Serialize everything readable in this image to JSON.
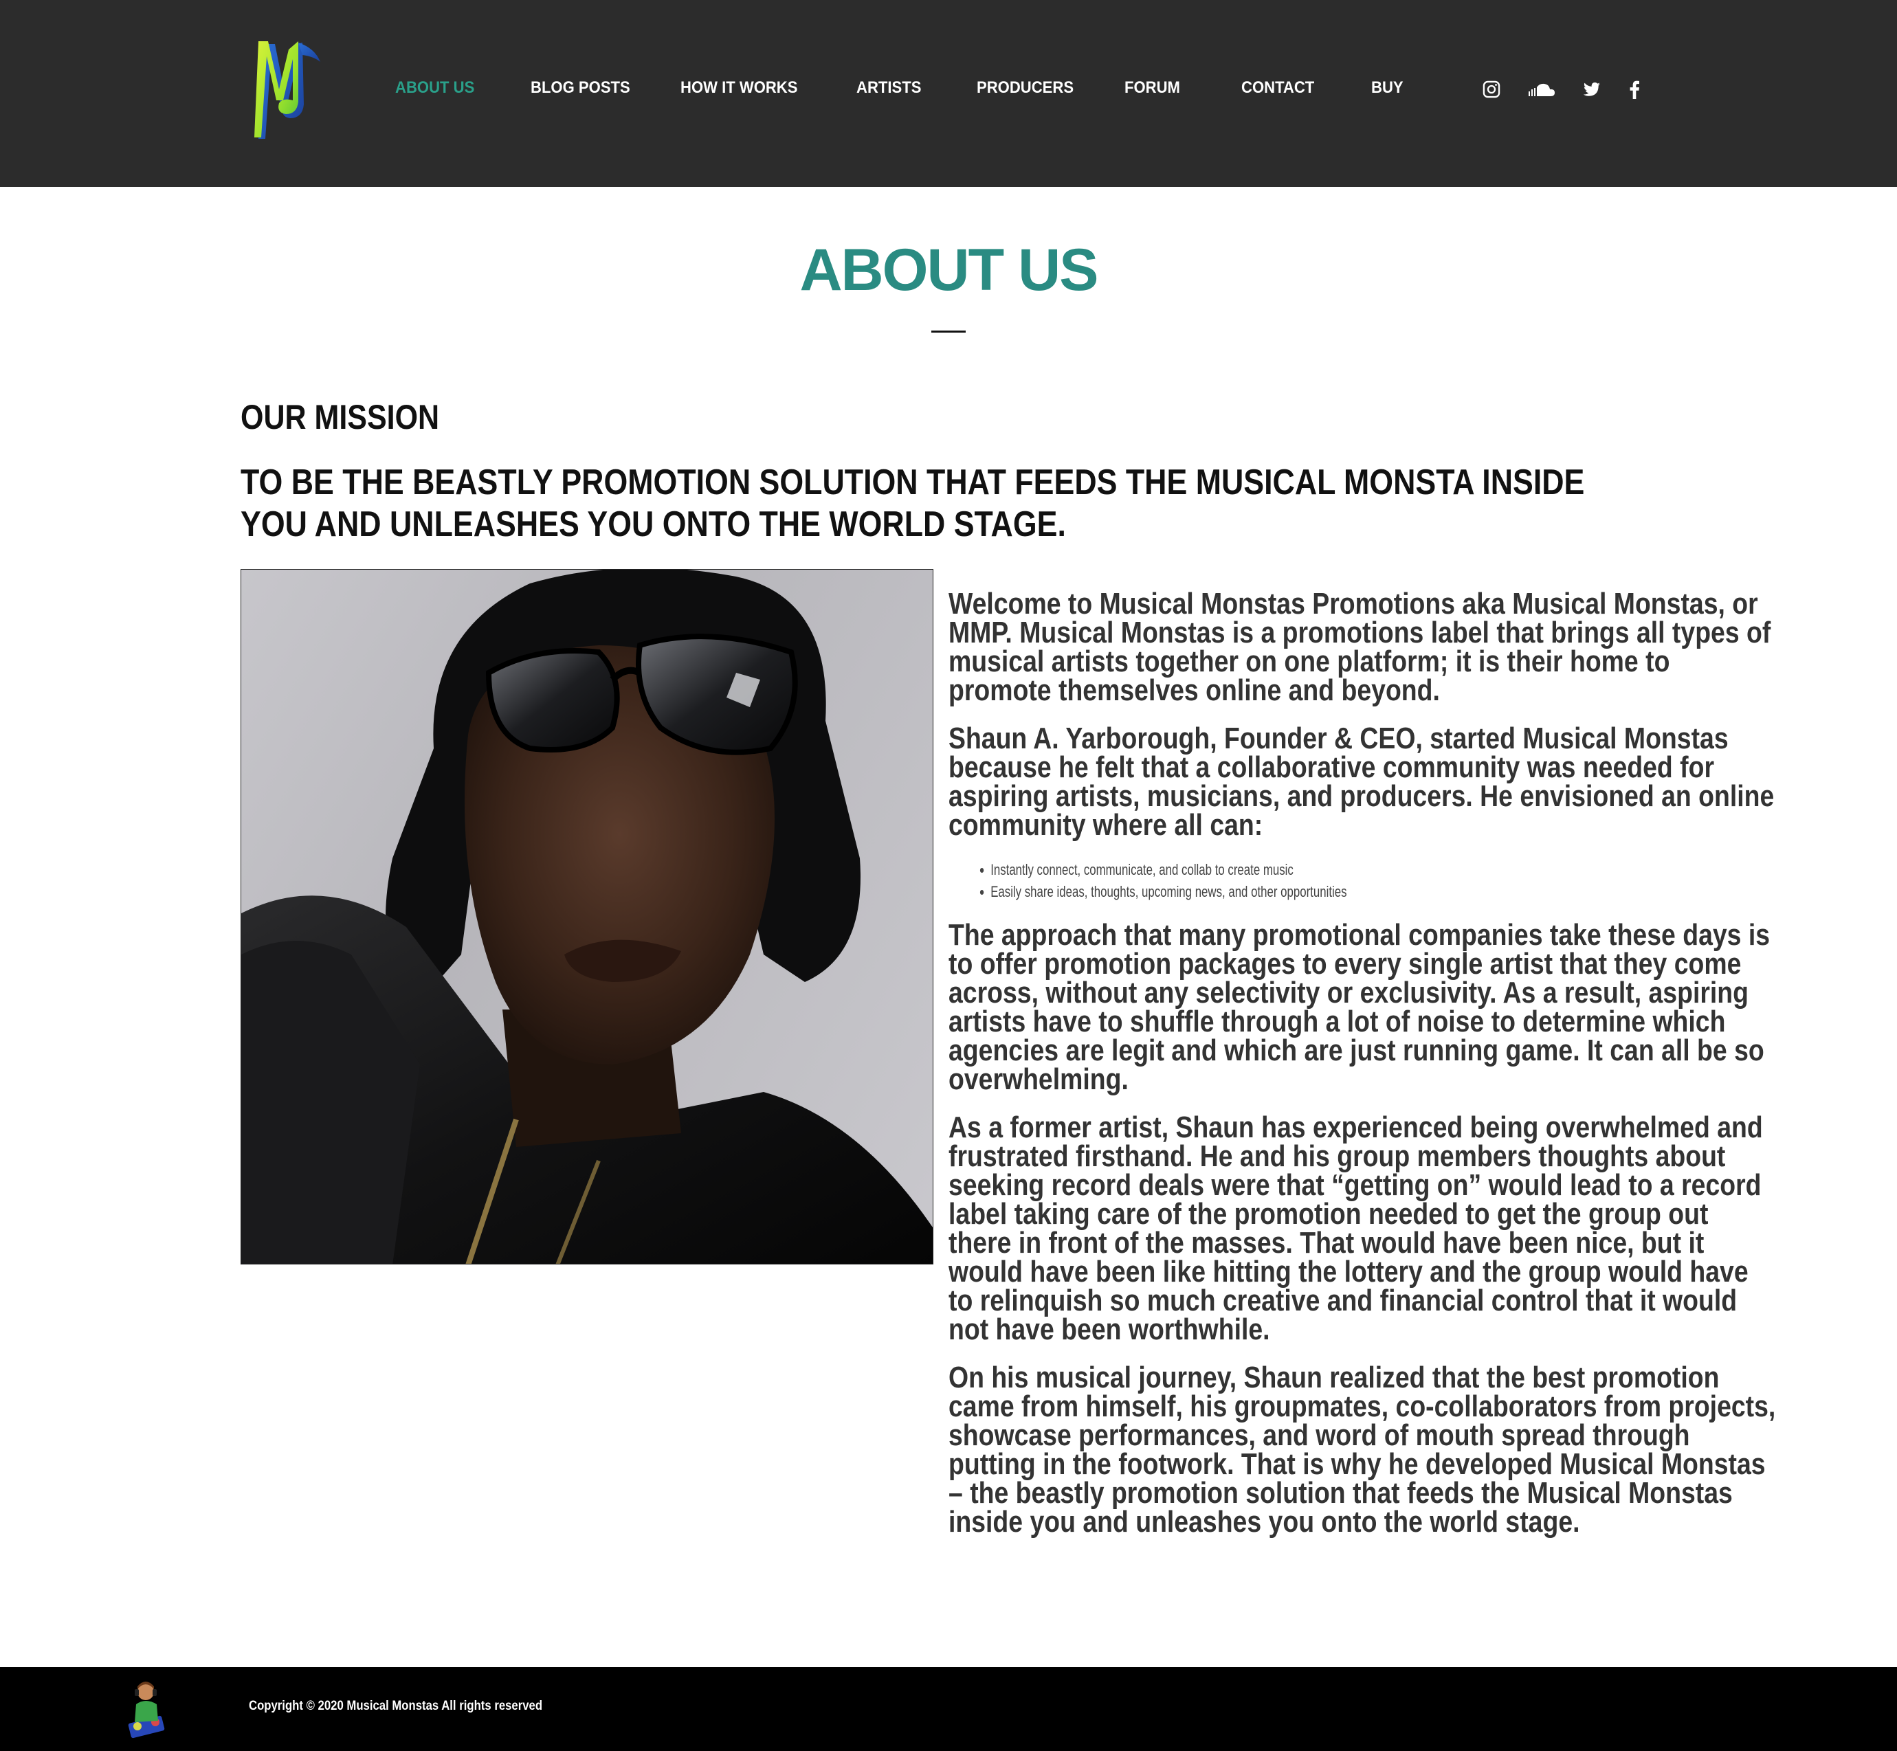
{
  "nav": {
    "items": [
      {
        "label": "ABOUT US",
        "active": true
      },
      {
        "label": "BLOG POSTS"
      },
      {
        "label": "HOW IT WORKS"
      },
      {
        "label": "ARTISTS"
      },
      {
        "label": "PRODUCERS"
      },
      {
        "label": "FORUM"
      },
      {
        "label": "CONTACT"
      },
      {
        "label": "BUY"
      }
    ],
    "social_icons": [
      "instagram-icon",
      "soundcloud-icon",
      "twitter-icon",
      "facebook-icon"
    ],
    "active_color": "#2aa08a",
    "background": "#2c2c2c"
  },
  "page": {
    "title": "ABOUT US",
    "mission_heading": "OUR MISSION",
    "mission_statement": "TO BE THE BEASTLY PROMOTION SOLUTION THAT FEEDS THE MUSICAL MONSTA INSIDE YOU AND UNLEASHES YOU ONTO THE WORLD STAGE.",
    "title_color": "#2a8b82"
  },
  "content": {
    "paragraphs": [
      "Welcome to Musical Monstas Promotions aka Musical Monstas, or MMP. Musical Monstas is a promotions label that brings all types of musical artists together on one platform; it is their home to promote themselves online and beyond.",
      "Shaun A. Yarborough, Founder & CEO, started Musical Monstas because he felt that a collaborative community was needed for aspiring artists, musicians, and producers. He envisioned an online community where all can:",
      "The approach that many promotional companies take these days is to offer promotion packages to every single artist that they come across, without any selectivity or exclusivity. As a result, aspiring artists have to shuffle through a lot of noise to determine which agencies are legit and which are just running game. It can all be so overwhelming.",
      "As a former artist, Shaun has experienced being overwhelmed and frustrated firsthand. He and his group members thoughts about seeking record deals were that “getting on” would lead to a record label taking care of the promotion needed to get the group out there in front of the masses. That would have been nice, but it would have been like hitting the lottery and the group would have to relinquish so much creative and financial control that it would not have been worthwhile.",
      "On his musical journey, Shaun realized that the best promotion came from himself, his groupmates, co-collaborators from projects, showcase performances, and word of mouth spread through putting in the footwork. That is why he developed Musical Monstas – the beastly promotion solution that feeds the Musical Monstas inside you and unleashes you onto the world stage."
    ],
    "bullets": [
      "Instantly connect, communicate, and collab to create music",
      "Easily share ideas, thoughts, upcoming news, and other opportunities"
    ]
  },
  "footer": {
    "copyright": "Copyright © 2020 Musical Monstas All rights reserved"
  }
}
